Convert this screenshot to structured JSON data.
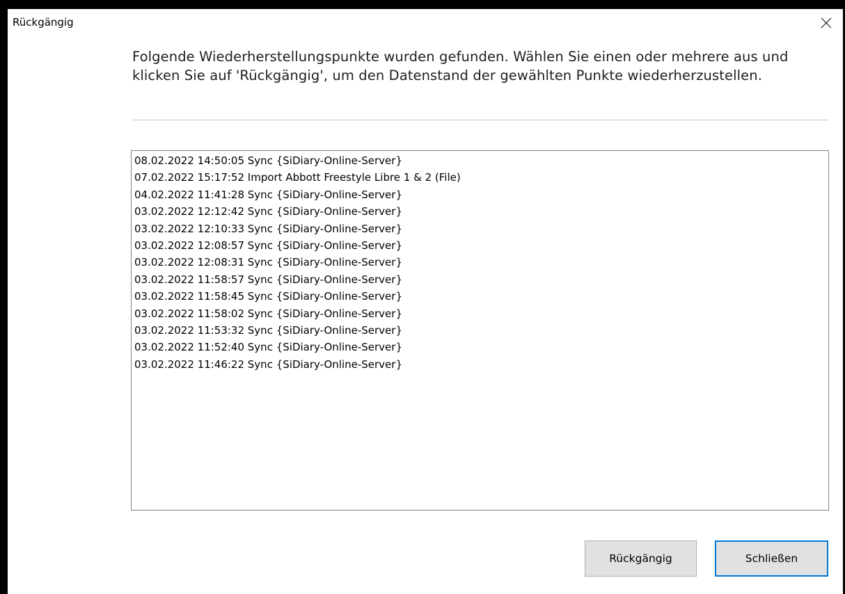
{
  "window": {
    "title": "Rückgängig"
  },
  "instruction": {
    "text": "Folgende Wiederherstellungspunkte wurden gefunden. Wählen Sie einen oder mehrere aus und klicken Sie auf 'Rückgängig', um den Datenstand der gewählten Punkte wiederherzustellen."
  },
  "restore_points": [
    "08.02.2022 14:50:05 Sync {SiDiary-Online-Server}",
    "07.02.2022 15:17:52 Import Abbott Freestyle Libre 1 & 2 (File)",
    "04.02.2022 11:41:28 Sync {SiDiary-Online-Server}",
    "03.02.2022 12:12:42 Sync {SiDiary-Online-Server}",
    "03.02.2022 12:10:33 Sync {SiDiary-Online-Server}",
    "03.02.2022 12:08:57 Sync {SiDiary-Online-Server}",
    "03.02.2022 12:08:31 Sync {SiDiary-Online-Server}",
    "03.02.2022 11:58:57 Sync {SiDiary-Online-Server}",
    "03.02.2022 11:58:45 Sync {SiDiary-Online-Server}",
    "03.02.2022 11:58:02 Sync {SiDiary-Online-Server}",
    "03.02.2022 11:53:32 Sync {SiDiary-Online-Server}",
    "03.02.2022 11:52:40 Sync {SiDiary-Online-Server}",
    "03.02.2022 11:46:22 Sync {SiDiary-Online-Server}"
  ],
  "buttons": {
    "undo_label": "Rückgängig",
    "close_label": "Schließen"
  },
  "icons": {
    "close": "close-icon"
  },
  "colors": {
    "focus_border": "#0078d7",
    "button_face": "#e1e1e1"
  }
}
